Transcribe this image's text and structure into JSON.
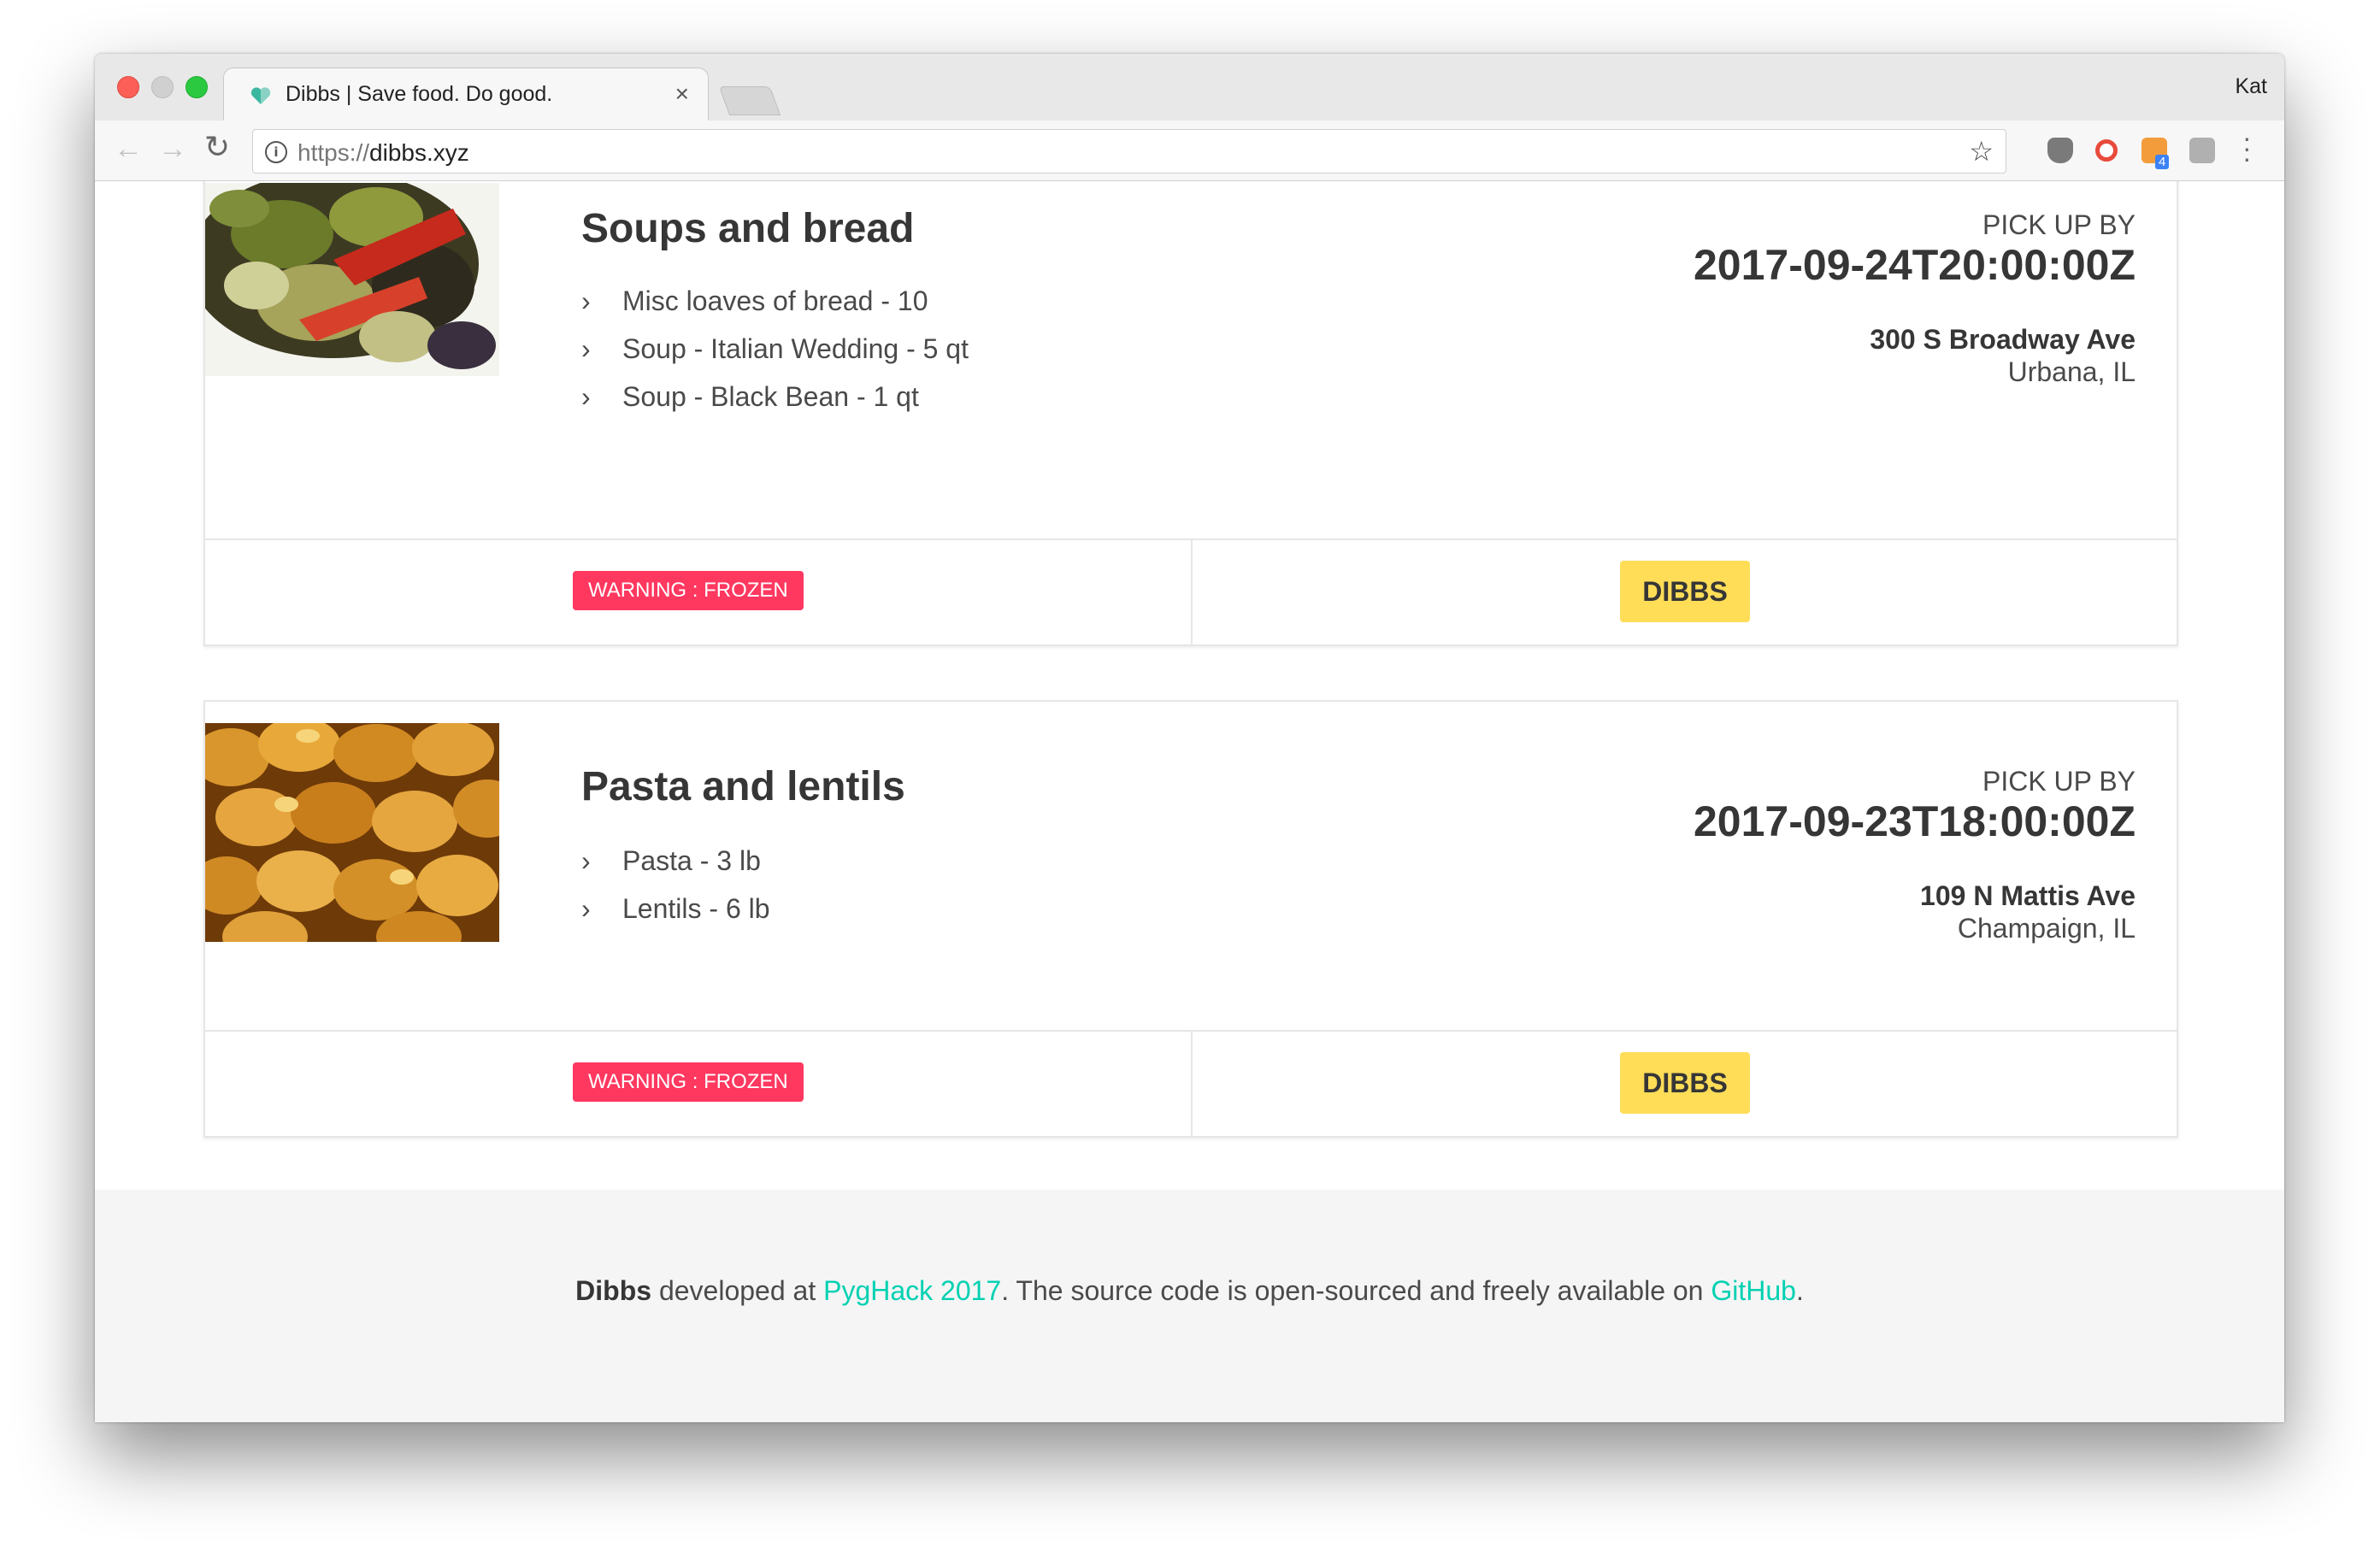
{
  "browser": {
    "tab_title": "Dibbs | Save food. Do good.",
    "tab_close": "×",
    "profile_name": "Kat",
    "url_scheme": "https://",
    "url_host": "dibbs.xyz",
    "extension_badge": "4"
  },
  "listings": [
    {
      "title": "Soups and bread",
      "image_icon": "grilled-vegetables-photo",
      "items": [
        "Misc loaves of bread - 10",
        "Soup - Italian Wedding - 5 qt",
        "Soup - Black Bean - 1 qt"
      ],
      "pickup_label": "PICK UP BY",
      "pickup_time": "2017-09-24T20:00:00Z",
      "street": "300 S Broadway Ave",
      "city": "Urbana, IL",
      "warning": "WARNING : FROZEN",
      "action_label": "DIBBS"
    },
    {
      "title": "Pasta and lentils",
      "image_icon": "bread-rolls-photo",
      "items": [
        "Pasta - 3 lb",
        "Lentils - 6 lb"
      ],
      "pickup_label": "PICK UP BY",
      "pickup_time": "2017-09-23T18:00:00Z",
      "street": "109 N Mattis Ave",
      "city": "Champaign, IL",
      "warning": "WARNING : FROZEN",
      "action_label": "DIBBS"
    }
  ],
  "footer": {
    "brand": "Dibbs",
    "text_1": " developed at ",
    "link_1": "PygHack 2017",
    "text_2": ". The source code is open-sourced and freely available on ",
    "link_2": "GitHub",
    "text_3": "."
  },
  "colors": {
    "warning_bg": "#ff3860",
    "dibbs_button": "#ffdd57",
    "link": "#00d1b2",
    "footer_bg": "#f5f5f5"
  }
}
